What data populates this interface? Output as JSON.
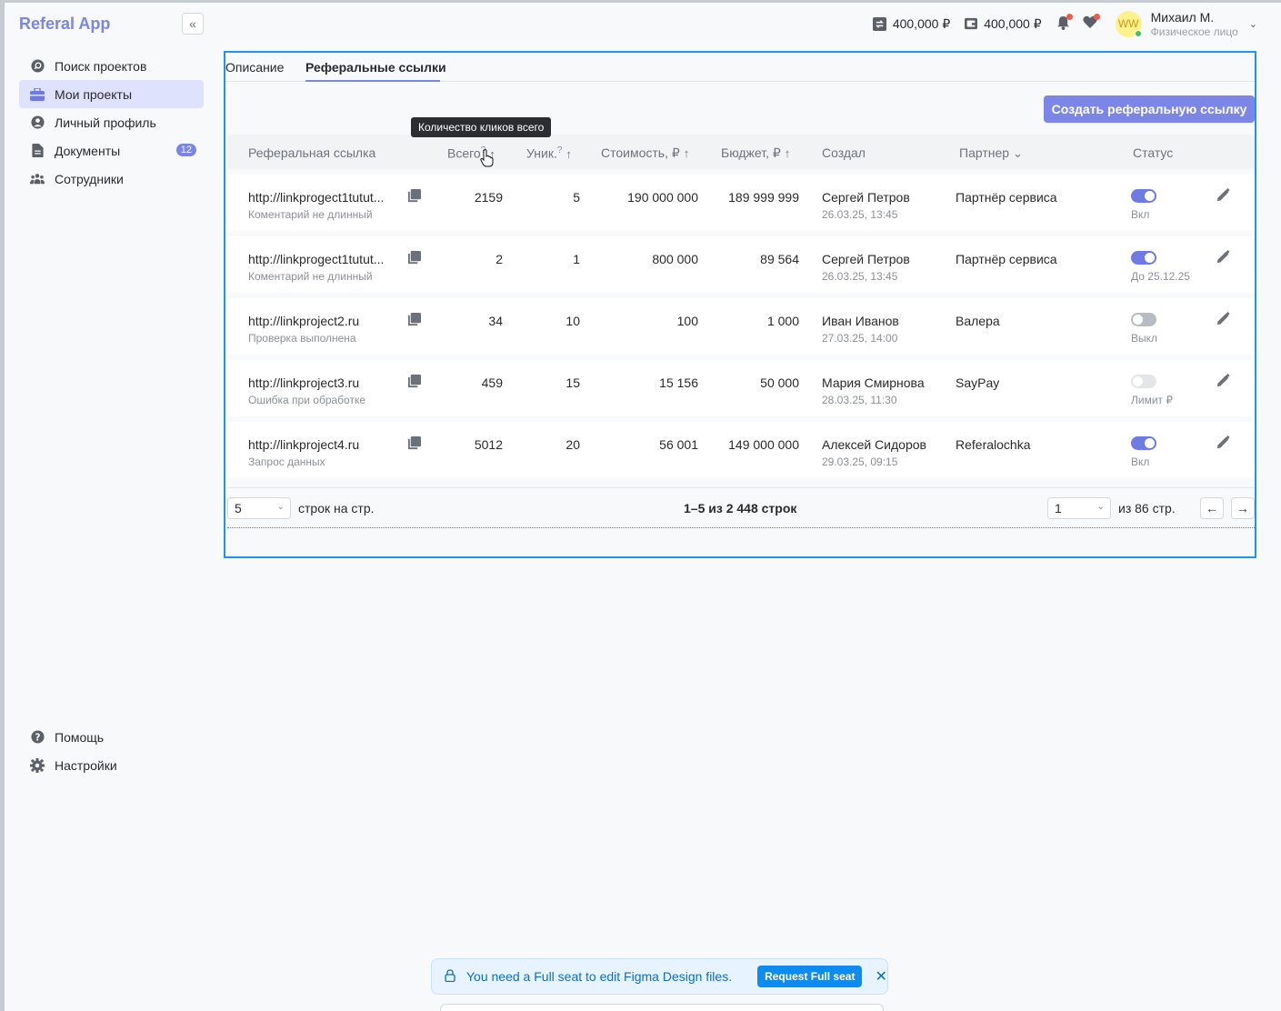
{
  "app": {
    "title": "Referal App"
  },
  "sidebar": {
    "items": [
      {
        "label": "Поиск проектов",
        "icon": "search-icon"
      },
      {
        "label": "Мои проекты",
        "icon": "briefcase-icon",
        "active": true
      },
      {
        "label": "Личный профиль",
        "icon": "user-icon"
      },
      {
        "label": "Документы",
        "icon": "document-icon",
        "badge": "12"
      },
      {
        "label": "Сотрудники",
        "icon": "team-icon"
      }
    ],
    "bottom": [
      {
        "label": "Помощь",
        "icon": "help-icon"
      },
      {
        "label": "Настройки",
        "icon": "gear-icon"
      }
    ]
  },
  "topbar": {
    "balance1": "400,000 ₽",
    "balance2": "400,000 ₽",
    "avatar_initials": "WW",
    "user_name": "Михаил М.",
    "user_role": "Физическое лицо"
  },
  "tabs": [
    {
      "label": "Описание"
    },
    {
      "label": "Реферальные ссылки",
      "active": true
    }
  ],
  "create_button": "Создать реферальную ссылку",
  "tooltip": "Количество кликов всего",
  "table": {
    "headers": {
      "link": "Реферальная ссылка",
      "total": "Всего",
      "unique": "Уник.",
      "cost": "Стоимость, ₽",
      "budget": "Бюджет, ₽",
      "created": "Создал",
      "partner": "Партнер",
      "status": "Статус"
    },
    "rows": [
      {
        "link": "http://linkprogect1tutut...",
        "comment": "Коментарий не длинный",
        "total": "2159",
        "unique": "5",
        "cost": "190 000 000",
        "budget": "189 999 999",
        "creator": "Сергей Петров",
        "date": "26.03.25, 13:45",
        "partner": "Партнёр сервиса",
        "toggle": "on",
        "status": "Вкл"
      },
      {
        "link": "http://linkprogect1tutut...",
        "comment": "Коментарий не длинный",
        "total": "2",
        "unique": "1",
        "cost": "800 000",
        "budget": "89 564",
        "creator": "Сергей Петров",
        "date": "26.03.25, 13:45",
        "partner": "Партнёр сервиса",
        "toggle": "on",
        "status": "До 25.12.25"
      },
      {
        "link": "http://linkproject2.ru",
        "comment": "Проверка выполнена",
        "total": "34",
        "unique": "10",
        "cost": "100",
        "budget": "1 000",
        "creator": "Иван Иванов",
        "date": "27.03.25, 14:00",
        "partner": "Валера",
        "toggle": "off",
        "status": "Выкл"
      },
      {
        "link": "http://linkproject3.ru",
        "comment": "Ошибка при обработке",
        "total": "459",
        "unique": "15",
        "cost": "15 156",
        "budget": "50 000",
        "creator": "Мария Смирнова",
        "date": "28.03.25, 11:30",
        "partner": "SayPay",
        "toggle": "disabled",
        "status": "Лимит ₽"
      },
      {
        "link": "http://linkproject4.ru",
        "comment": "Запрос данных",
        "total": "5012",
        "unique": "20",
        "cost": "56 001",
        "budget": "149 000 000",
        "creator": "Алексей Сидоров",
        "date": "29.03.25, 09:15",
        "partner": "Referalochka",
        "toggle": "on",
        "status": "Вкл"
      }
    ]
  },
  "pagination": {
    "per_page": "5",
    "per_page_label": "строк на стр.",
    "range": "1–5 из 2 448 строк",
    "page": "1",
    "pages_label": "из 86 стр."
  },
  "figma_banner": {
    "text": "You need a Full seat to edit Figma Design files.",
    "button": "Request Full seat"
  }
}
